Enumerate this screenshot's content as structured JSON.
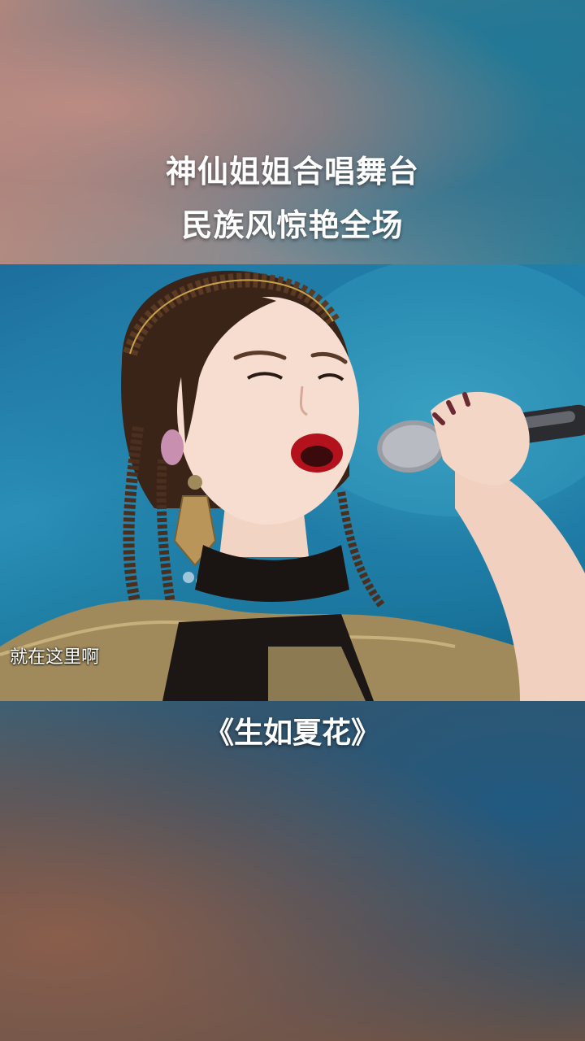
{
  "header": {
    "title_line1": "神仙姐姐合唱舞台",
    "title_line2": "民族风惊艳全场"
  },
  "video": {
    "subtitle": "就在这里啊"
  },
  "song": {
    "title": "《生如夏花》"
  },
  "colors": {
    "stage_blue": "#1f7ca6",
    "title_text": "#ffffff",
    "lip_red": "#b3121c",
    "costume_gold": "#a08a5c"
  }
}
